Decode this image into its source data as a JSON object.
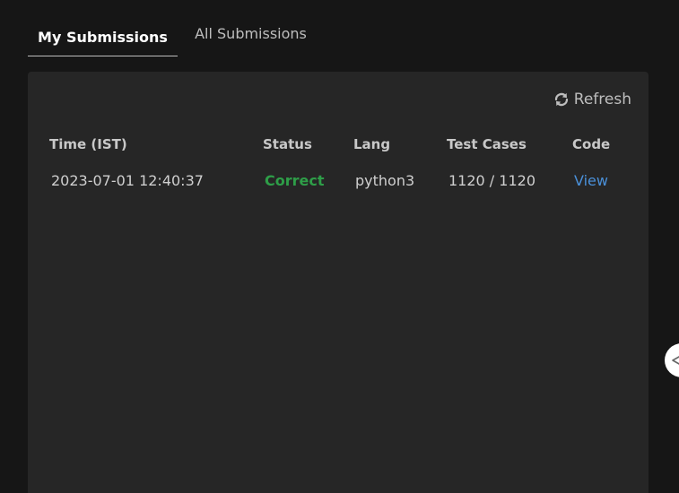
{
  "tabs": [
    {
      "label": "My Submissions"
    },
    {
      "label": "All Submissions"
    }
  ],
  "toolbar": {
    "refresh_label": "Refresh",
    "refresh_icon": "refresh-icon"
  },
  "table": {
    "headers": [
      "Time (IST)",
      "Status",
      "Lang",
      "Test Cases",
      "Code"
    ],
    "rows": [
      {
        "time": "2023-07-01 12:40:37",
        "status": "Correct",
        "lang": "python3",
        "test_cases": "1120 / 1120",
        "code": "View"
      }
    ]
  },
  "colors": {
    "background": "#161616",
    "panel": "#262626",
    "status_correct": "#2e9e48",
    "link": "#4a90d9"
  },
  "side_handle": {
    "icon": "chevron-left-icon"
  }
}
